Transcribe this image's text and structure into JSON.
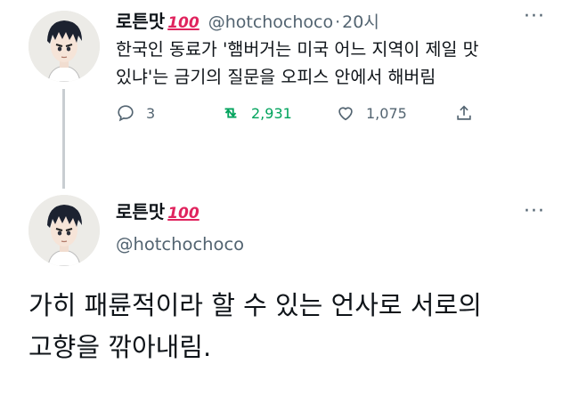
{
  "colors": {
    "handle": "#536471",
    "retweet_active": "#00a35c",
    "thread_line": "#c8cdd1"
  },
  "tweet1": {
    "avatar_icon": "anime-character-avatar",
    "name": "로튼맛",
    "badge": "💯",
    "badge_text": "100",
    "handle": "@hotchochoco",
    "separator": "·",
    "time": "20시",
    "more_label": "···",
    "text_line1": "한국인 동료가 '햄버거는 미국 어느 지역이 제일 맛",
    "text_line2": "있냐'는 금기의 질문을 오피스 안에서 해버림",
    "actions": {
      "reply": {
        "icon": "reply-icon",
        "count": "3"
      },
      "retweet": {
        "icon": "retweet-icon",
        "count": "2,931"
      },
      "like": {
        "icon": "heart-icon",
        "count": "1,075"
      },
      "share": {
        "icon": "share-icon"
      }
    }
  },
  "tweet2": {
    "avatar_icon": "anime-character-avatar",
    "name": "로튼맛",
    "badge_text": "100",
    "handle": "@hotchochoco",
    "more_label": "···",
    "text_line1": "가히 패륜적이라 할 수 있는 언사로 서로의",
    "text_line2": "고향을 깎아내림."
  }
}
